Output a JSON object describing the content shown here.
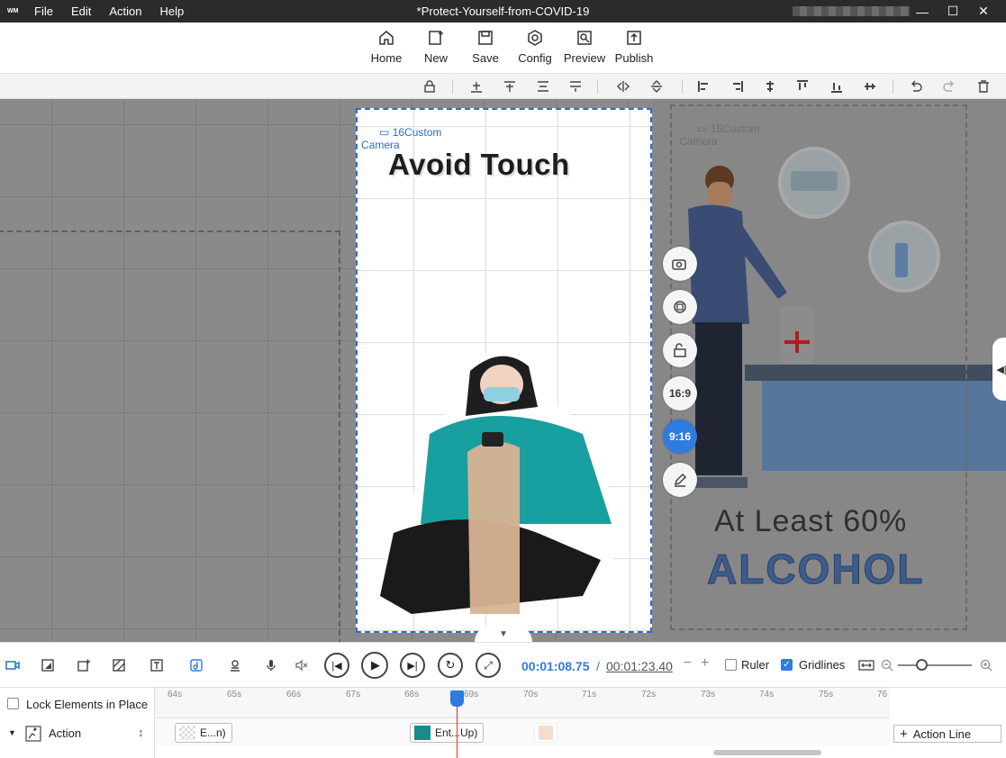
{
  "window": {
    "logo": "WM",
    "title": "*Protect-Yourself-from-COVID-19",
    "menu": [
      "File",
      "Edit",
      "Action",
      "Help"
    ],
    "controls": {
      "minimize": "—",
      "maximize": "☐",
      "close": "✕"
    }
  },
  "toolbar": {
    "items": [
      {
        "label": "Home",
        "icon": "home-icon"
      },
      {
        "label": "New",
        "icon": "new-icon"
      },
      {
        "label": "Save",
        "icon": "save-icon"
      },
      {
        "label": "Config",
        "icon": "config-icon"
      },
      {
        "label": "Preview",
        "icon": "preview-icon"
      },
      {
        "label": "Publish",
        "icon": "publish-icon"
      }
    ]
  },
  "canvas": {
    "camera_left_label": "16Custom\nCamera",
    "camera_right_label": "15Custom\nCamera",
    "avoid_text": "Avoid Touch",
    "at_least_text": "At Least 60%",
    "alcohol_text": "ALCOHOL",
    "side_buttons": {
      "ratio_169": "16:9",
      "ratio_916": "9:16"
    },
    "colors": {
      "selected_border": "#2b6cc4",
      "accent": "#2f7be0"
    }
  },
  "timeline_toolbar": {
    "current_time": "00:01:08.75",
    "separator": "/",
    "total_time": "00:01:23.40",
    "zoom_out": "−",
    "zoom_in": "+",
    "ruler_label": "Ruler",
    "ruler_checked": false,
    "gridlines_label": "Gridlines",
    "gridlines_checked": true,
    "zoom_level": 0.32
  },
  "timeline": {
    "lock_label": "Lock Elements in Place",
    "action_label": "Action",
    "ticks": [
      "64s",
      "65s",
      "66s",
      "67s",
      "68s",
      "69s",
      "70s",
      "71s",
      "72s",
      "73s",
      "74s",
      "75s",
      "76"
    ],
    "clips": [
      {
        "label": "E...n)"
      },
      {
        "label": "Ent...Up)"
      },
      {
        "label": ""
      }
    ],
    "action_line_label": "Action Line"
  }
}
